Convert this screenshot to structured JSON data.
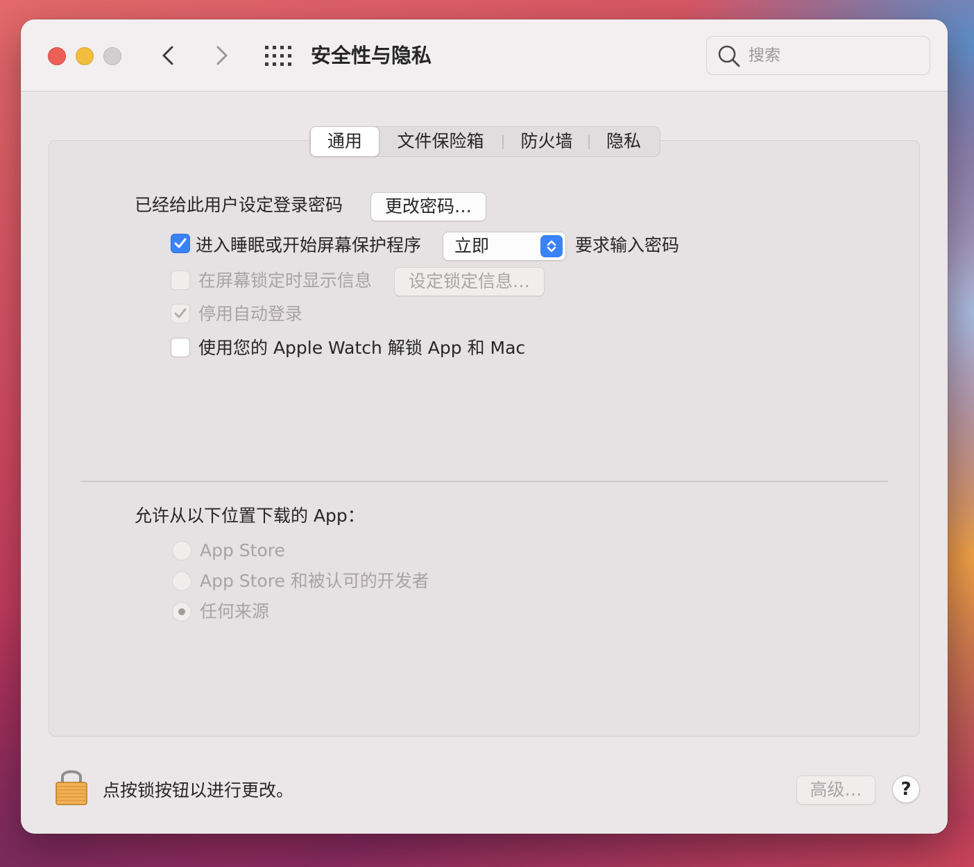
{
  "window": {
    "title": "安全性与隐私",
    "search_placeholder": "搜索"
  },
  "tabs": [
    {
      "label": "通用",
      "active": true
    },
    {
      "label": "文件保险箱",
      "active": false
    },
    {
      "label": "防火墙",
      "active": false
    },
    {
      "label": "隐私",
      "active": false
    }
  ],
  "general": {
    "password_label": "已经给此用户设定登录密码",
    "change_password_button": "更改密码…",
    "require_password": {
      "checked": true,
      "label": "进入睡眠或开始屏幕保护程序",
      "select_value": "立即",
      "suffix": "要求输入密码"
    },
    "lock_message": {
      "checked": false,
      "enabled": false,
      "label": "在屏幕锁定时显示信息",
      "button": "设定锁定信息…"
    },
    "disable_auto_login": {
      "checked": true,
      "enabled": false,
      "label": "停用自动登录"
    },
    "apple_watch": {
      "checked": false,
      "label": "使用您的 Apple Watch 解锁 App 和 Mac"
    }
  },
  "downloads": {
    "heading": "允许从以下位置下载的 App：",
    "options": [
      {
        "label": "App Store",
        "selected": false
      },
      {
        "label": "App Store 和被认可的开发者",
        "selected": false
      },
      {
        "label": "任何来源",
        "selected": true
      }
    ]
  },
  "footer": {
    "lock_text": "点按锁按钮以进行更改。",
    "advanced_button": "高级…",
    "help_button": "?"
  },
  "colors": {
    "accent": "#3a82f7",
    "close": "#ec5f57",
    "minimize": "#f2be3f"
  }
}
